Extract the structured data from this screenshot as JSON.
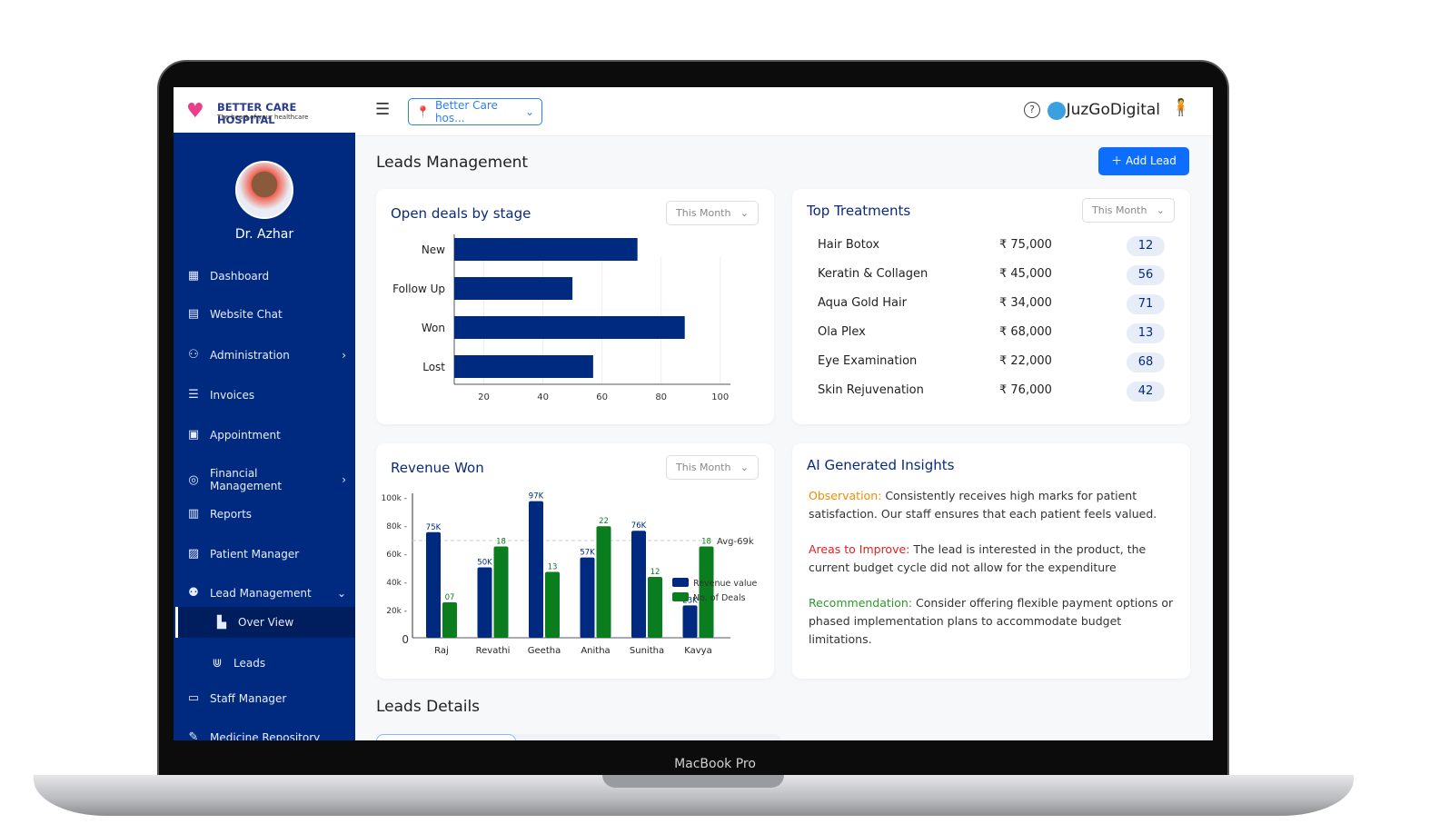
{
  "device_label": "MacBook Pro",
  "brand": {
    "name": "BETTER CARE HOSPITAL",
    "tagline": "The heart of your healthcare"
  },
  "header": {
    "location": "Better Care hos...",
    "company": "JuzGoDigital"
  },
  "user": {
    "name": "Dr. Azhar"
  },
  "sidebar": {
    "items": [
      {
        "label": "Dashboard",
        "icon": "dashboard-icon"
      },
      {
        "label": "Website Chat",
        "icon": "chat-icon"
      },
      {
        "label": "Administration",
        "icon": "admin-icon",
        "chevron": "right"
      },
      {
        "label": "Invoices",
        "icon": "invoice-icon"
      },
      {
        "label": "Appointment",
        "icon": "calendar-icon"
      },
      {
        "label": "Financial Management",
        "icon": "finance-icon",
        "chevron": "right"
      },
      {
        "label": "Reports",
        "icon": "reports-icon"
      },
      {
        "label": "Patient Manager",
        "icon": "patient-icon"
      },
      {
        "label": "Lead Management",
        "icon": "leads-group-icon",
        "chevron": "down"
      }
    ],
    "sub_items": [
      {
        "label": "Over View",
        "active": true
      },
      {
        "label": "Leads"
      }
    ],
    "items_after": [
      {
        "label": "Staff Manager"
      },
      {
        "label": "Medicine Repository"
      }
    ]
  },
  "page": {
    "title": "Leads Management",
    "add_button": "Add Lead",
    "section2": "Leads Details"
  },
  "colors": {
    "primary": "#002a80",
    "accent": "#0d6efd",
    "green": "#0a7d1e"
  },
  "open_deals": {
    "title": "Open deals by stage",
    "filter": "This Month"
  },
  "revenue": {
    "title": "Revenue Won",
    "filter": "This Month",
    "avg_label": "Avg-69k"
  },
  "top_treatments": {
    "title": "Top Treatments",
    "filter": "This Month",
    "rows": [
      {
        "name": "Hair Botox",
        "price": "₹ 75,000",
        "count": "12"
      },
      {
        "name": "Keratin & Collagen",
        "price": "₹ 45,000",
        "count": "56"
      },
      {
        "name": "Aqua Gold Hair",
        "price": "₹ 34,000",
        "count": "71"
      },
      {
        "name": "Ola Plex",
        "price": "₹ 68,000",
        "count": "13"
      },
      {
        "name": "Eye Examination",
        "price": "₹ 22,000",
        "count": "68"
      },
      {
        "name": "Skin Rejuvenation",
        "price": "₹ 76,000",
        "count": "42"
      }
    ]
  },
  "insights": {
    "title": "AI Generated Insights",
    "items": [
      {
        "label": "Observation:",
        "color": "#f08c00",
        "text": "Consistently receives high marks for patient satisfaction. Our staff ensures that each patient feels valued."
      },
      {
        "label": "Areas to Improve:",
        "color": "#e02020",
        "text": "The lead is interested in the product, the current budget cycle did not allow for the expenditure"
      },
      {
        "label": "Recommendation:",
        "color": "#2a9a2a",
        "text": "Consider offering flexible payment options or phased implementation plans to accommodate budget limitations."
      }
    ]
  },
  "chart_data": [
    {
      "type": "bar",
      "orientation": "horizontal",
      "title": "Open deals by stage",
      "categories": [
        "New",
        "Follow Up",
        "Won",
        "Lost"
      ],
      "values": [
        72,
        50,
        88,
        57
      ],
      "xticks": [
        20,
        40,
        60,
        80,
        100
      ],
      "xlim": [
        10,
        105
      ],
      "grid": true
    },
    {
      "type": "bar",
      "title": "Revenue Won",
      "categories": [
        "Raj",
        "Revathi",
        "Geetha",
        "Anitha",
        "Sunitha",
        "Kavya"
      ],
      "yticks": [
        "0",
        "20k",
        "40k",
        "60k",
        "80k",
        "100k"
      ],
      "ylim": [
        0,
        100000
      ],
      "series": [
        {
          "name": "Revenue value",
          "labels": [
            "75K",
            "50K",
            "97K",
            "57K",
            "76K",
            "23K"
          ],
          "values": [
            75000,
            50000,
            97000,
            57000,
            76000,
            23000
          ]
        },
        {
          "name": "No. of Deals",
          "labels": [
            "07",
            "18",
            "13",
            "22",
            "12",
            "18"
          ],
          "values": [
            7,
            18,
            13,
            22,
            12,
            18
          ]
        }
      ],
      "average": 69000,
      "legend": "top-right"
    }
  ]
}
